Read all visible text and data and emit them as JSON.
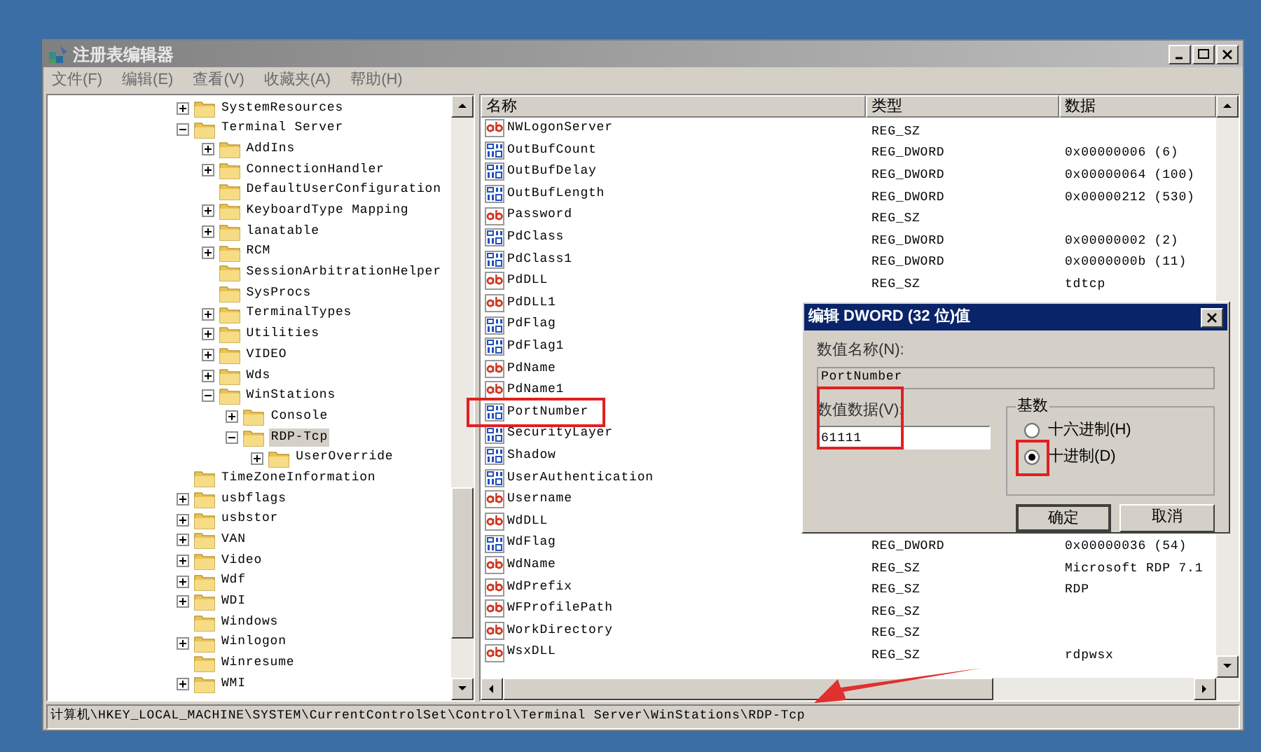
{
  "window": {
    "title": "注册表编辑器"
  },
  "menu": [
    "文件(F)",
    "编辑(E)",
    "查看(V)",
    "收藏夹(A)",
    "帮助(H)"
  ],
  "tree": [
    {
      "label": "SystemResources",
      "has_children": true,
      "expanded": false,
      "selected": false
    },
    {
      "label": "Terminal Server",
      "has_children": true,
      "expanded": true,
      "selected": false,
      "children": [
        {
          "label": "AddIns",
          "has_children": true,
          "expanded": false,
          "selected": false
        },
        {
          "label": "ConnectionHandler",
          "has_children": true,
          "expanded": false,
          "selected": false
        },
        {
          "label": "DefaultUserConfiguration",
          "has_children": false,
          "selected": false
        },
        {
          "label": "KeyboardType Mapping",
          "has_children": true,
          "expanded": false,
          "selected": false
        },
        {
          "label": "lanatable",
          "has_children": true,
          "expanded": false,
          "selected": false
        },
        {
          "label": "RCM",
          "has_children": true,
          "expanded": false,
          "selected": false
        },
        {
          "label": "SessionArbitrationHelper",
          "has_children": false,
          "selected": false
        },
        {
          "label": "SysProcs",
          "has_children": false,
          "selected": false
        },
        {
          "label": "TerminalTypes",
          "has_children": true,
          "expanded": false,
          "selected": false
        },
        {
          "label": "Utilities",
          "has_children": true,
          "expanded": false,
          "selected": false
        },
        {
          "label": "VIDEO",
          "has_children": true,
          "expanded": false,
          "selected": false
        },
        {
          "label": "Wds",
          "has_children": true,
          "expanded": false,
          "selected": false
        },
        {
          "label": "WinStations",
          "has_children": true,
          "expanded": true,
          "selected": false,
          "children": [
            {
              "label": "Console",
              "has_children": true,
              "expanded": false,
              "selected": false
            },
            {
              "label": "RDP-Tcp",
              "has_children": true,
              "expanded": true,
              "selected": true,
              "children": [
                {
                  "label": "UserOverride",
                  "has_children": true,
                  "expanded": false,
                  "selected": false
                }
              ]
            }
          ]
        }
      ]
    },
    {
      "label": "TimeZoneInformation",
      "has_children": false,
      "selected": false
    },
    {
      "label": "usbflags",
      "has_children": true,
      "expanded": false,
      "selected": false
    },
    {
      "label": "usbstor",
      "has_children": true,
      "expanded": false,
      "selected": false
    },
    {
      "label": "VAN",
      "has_children": true,
      "expanded": false,
      "selected": false
    },
    {
      "label": "Video",
      "has_children": true,
      "expanded": false,
      "selected": false
    },
    {
      "label": "Wdf",
      "has_children": true,
      "expanded": false,
      "selected": false
    },
    {
      "label": "WDI",
      "has_children": true,
      "expanded": false,
      "selected": false
    },
    {
      "label": "Windows",
      "has_children": false,
      "selected": false
    },
    {
      "label": "Winlogon",
      "has_children": true,
      "expanded": false,
      "selected": false
    },
    {
      "label": "Winresume",
      "has_children": false,
      "selected": false
    },
    {
      "label": "WMI",
      "has_children": true,
      "expanded": false,
      "selected": false
    }
  ],
  "table": {
    "columns": [
      "名称",
      "类型",
      "数据"
    ],
    "rows": [
      {
        "kind": "sz",
        "name": "NWLogonServer",
        "type": "REG_SZ"
      },
      {
        "kind": "dword",
        "name": "OutBufCount",
        "type": "REG_DWORD",
        "data": "0x00000006 (6)"
      },
      {
        "kind": "dword",
        "name": "OutBufDelay",
        "type": "REG_DWORD",
        "data": "0x00000064 (100)"
      },
      {
        "kind": "dword",
        "name": "OutBufLength",
        "type": "REG_DWORD",
        "data": "0x00000212 (530)"
      },
      {
        "kind": "sz",
        "name": "Password",
        "type": "REG_SZ"
      },
      {
        "kind": "dword",
        "name": "PdClass",
        "type": "REG_DWORD",
        "data": "0x00000002 (2)"
      },
      {
        "kind": "dword",
        "name": "PdClass1",
        "type": "REG_DWORD",
        "data": "0x0000000b (11)"
      },
      {
        "kind": "sz",
        "name": "PdDLL",
        "type": "REG_SZ",
        "data": "tdtcp"
      },
      {
        "kind": "sz",
        "name": "PdDLL1"
      },
      {
        "kind": "dword",
        "name": "PdFlag"
      },
      {
        "kind": "dword",
        "name": "PdFlag1"
      },
      {
        "kind": "sz",
        "name": "PdName"
      },
      {
        "kind": "sz",
        "name": "PdName1"
      },
      {
        "kind": "dword",
        "name": "PortNumber"
      },
      {
        "kind": "dword",
        "name": "SecurityLayer"
      },
      {
        "kind": "dword",
        "name": "Shadow"
      },
      {
        "kind": "dword",
        "name": "UserAuthentication"
      },
      {
        "kind": "sz",
        "name": "Username"
      },
      {
        "kind": "sz",
        "name": "WdDLL"
      },
      {
        "kind": "dword",
        "name": "WdFlag",
        "type": "REG_DWORD",
        "data": "0x00000036 (54)"
      },
      {
        "kind": "sz",
        "name": "WdName",
        "type": "REG_SZ",
        "data": "Microsoft RDP 7.1"
      },
      {
        "kind": "sz",
        "name": "WdPrefix",
        "type": "REG_SZ",
        "data": "RDP"
      },
      {
        "kind": "sz",
        "name": "WFProfilePath",
        "type": "REG_SZ"
      },
      {
        "kind": "sz",
        "name": "WorkDirectory",
        "type": "REG_SZ"
      },
      {
        "kind": "sz",
        "name": "WsxDLL",
        "type": "REG_SZ",
        "data": "rdpwsx"
      }
    ]
  },
  "status_bar": "计算机\\HKEY_LOCAL_MACHINE\\SYSTEM\\CurrentControlSet\\Control\\Terminal Server\\WinStations\\RDP-Tcp",
  "dialog": {
    "title": "编辑 DWORD (32 位)值",
    "name_label": "数值名称(N):",
    "name_value": "PortNumber",
    "data_label": "数值数据(V):",
    "data_value": "61111",
    "base": {
      "label": "基数",
      "options": [
        {
          "label": "十六进制(H)",
          "selected": false
        },
        {
          "label": "十进制(D)",
          "selected": true
        }
      ]
    },
    "buttons": [
      "确定",
      "取消"
    ]
  }
}
